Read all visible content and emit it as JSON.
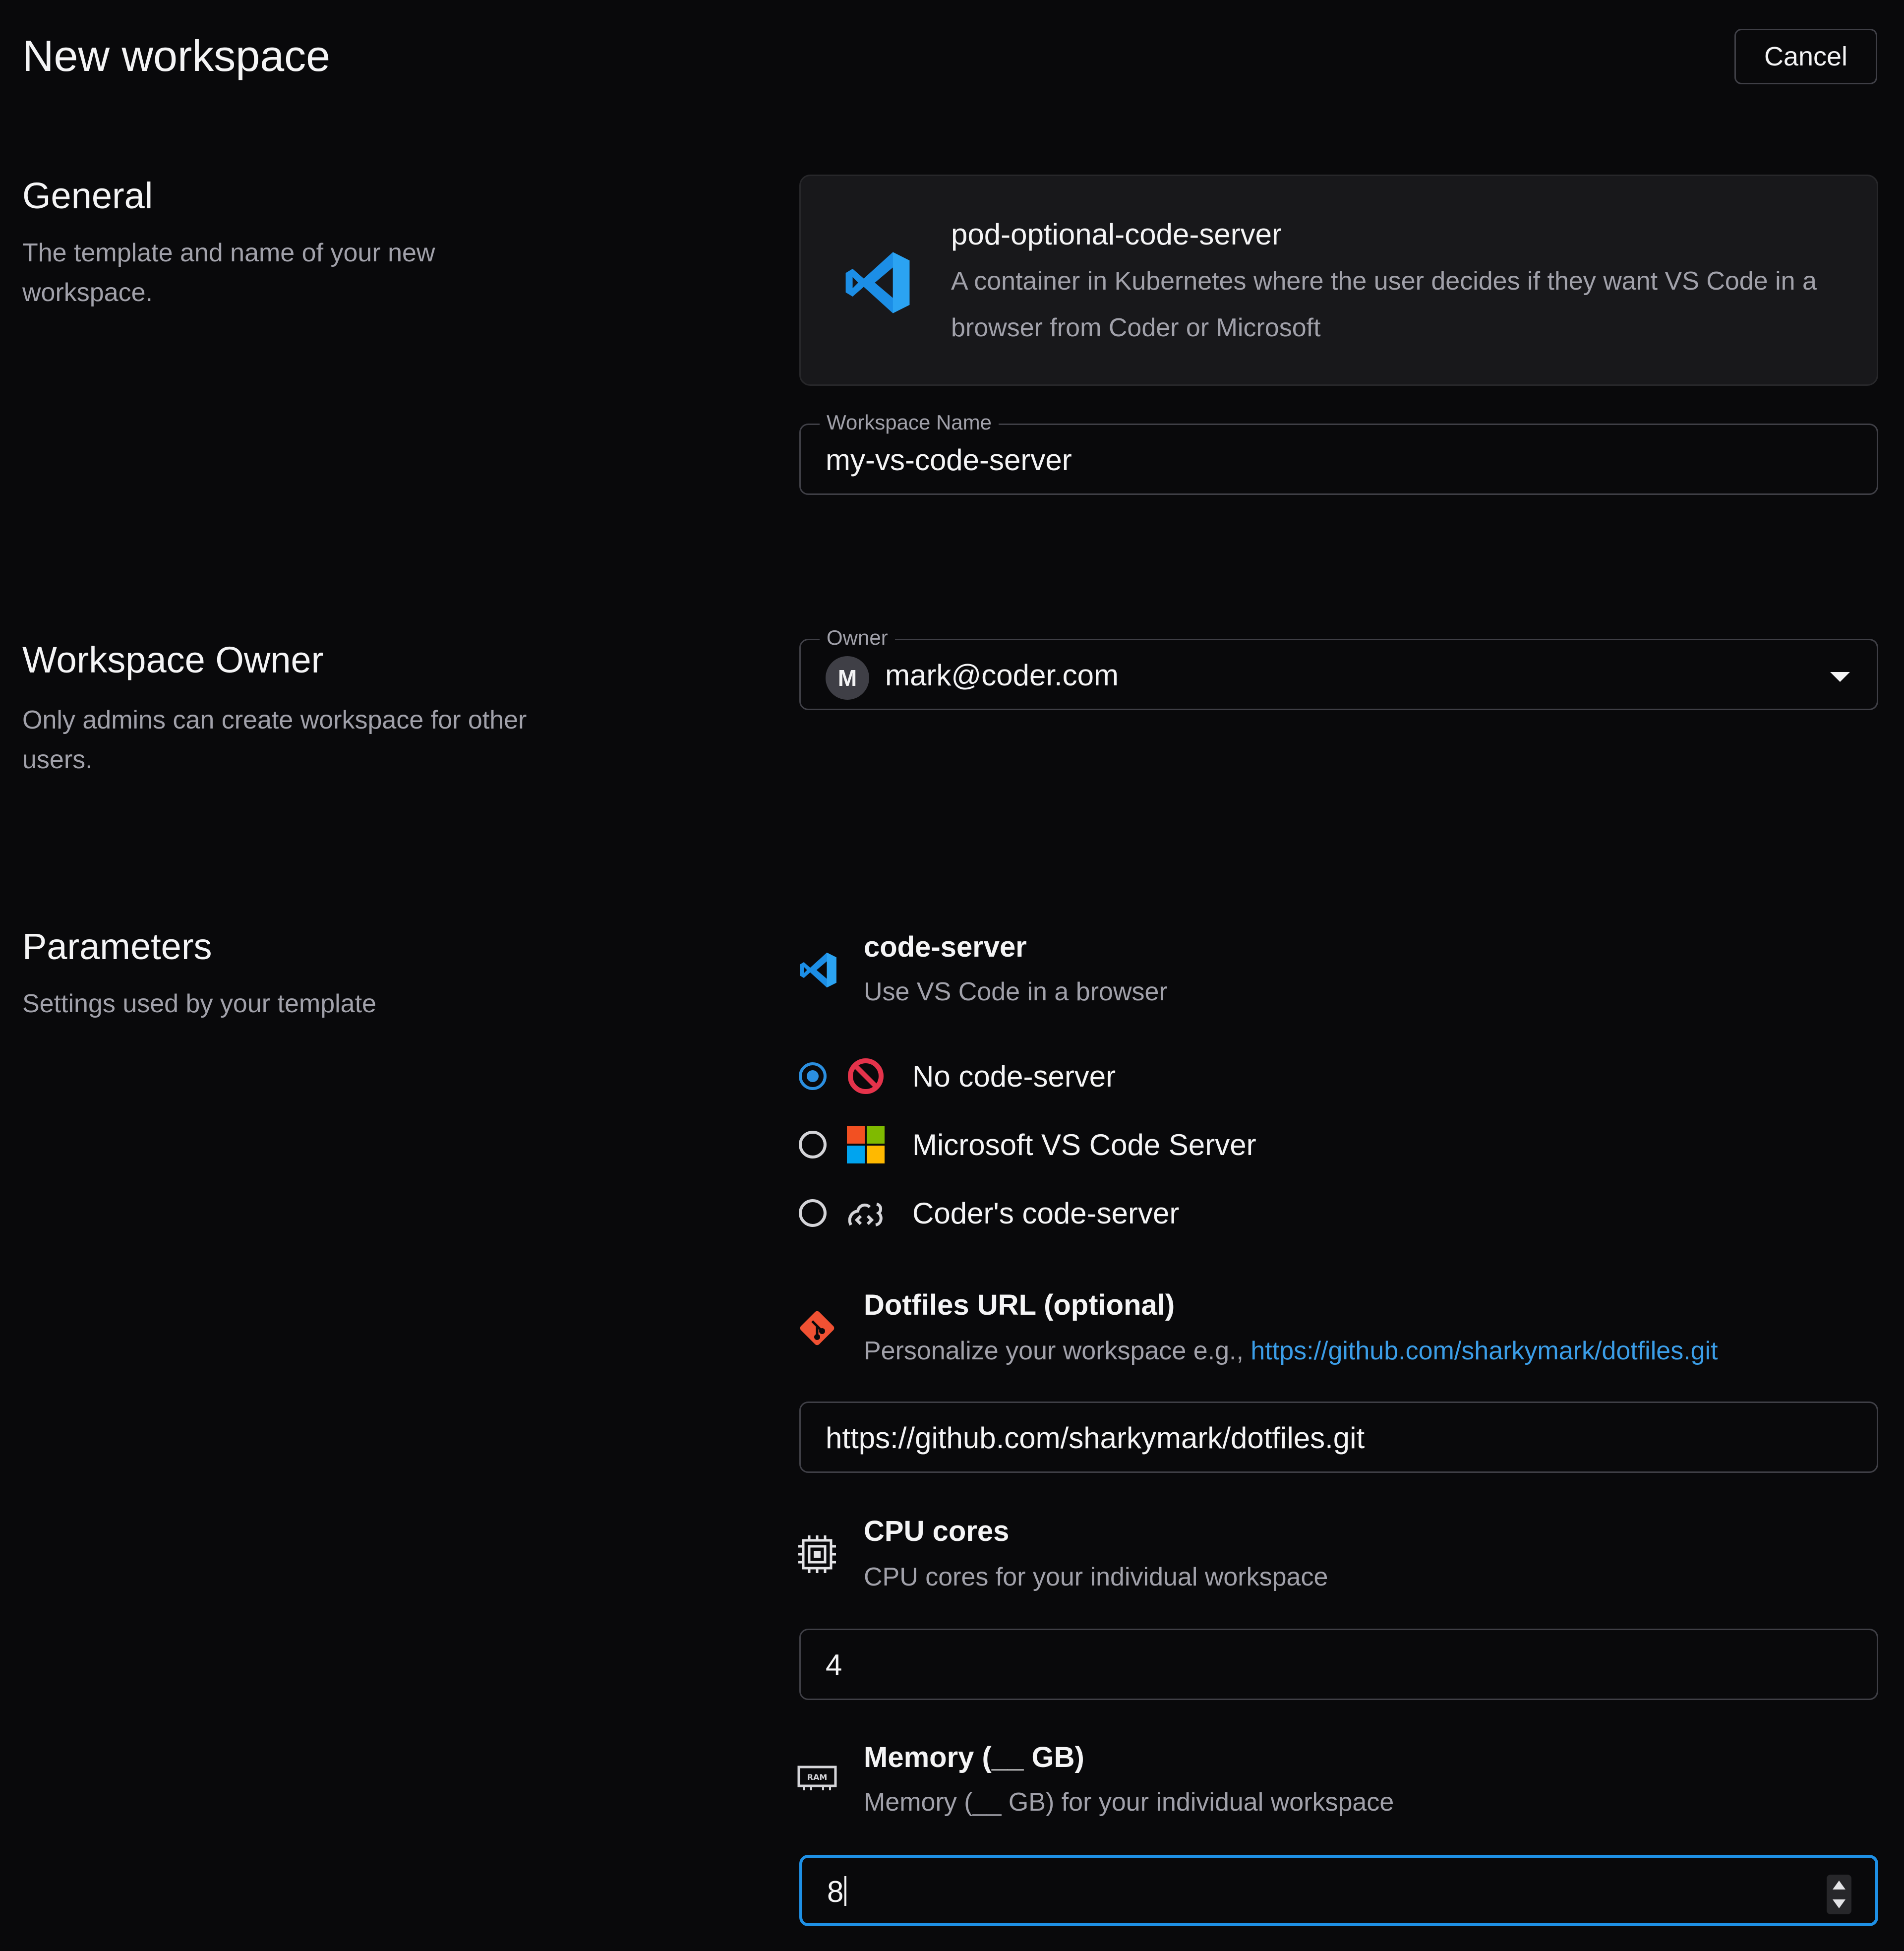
{
  "header": {
    "title": "New workspace",
    "cancel_label": "Cancel"
  },
  "general": {
    "title": "General",
    "description": "The template and name of your new workspace."
  },
  "template": {
    "icon": "vscode-icon",
    "name": "pod-optional-code-server",
    "description": "A container in Kubernetes where the user decides if they want VS Code in a browser from Coder or Microsoft"
  },
  "workspace_name": {
    "label": "Workspace Name",
    "value": "my-vs-code-server"
  },
  "owner_section": {
    "title": "Workspace Owner",
    "description": "Only admins can create workspace for other users."
  },
  "owner": {
    "label": "Owner",
    "avatar_initial": "M",
    "value": "mark@coder.com"
  },
  "parameters_section": {
    "title": "Parameters",
    "description": "Settings used by your template"
  },
  "code_server": {
    "icon": "vscode-icon",
    "title": "code-server",
    "description": "Use VS Code in a browser",
    "options": [
      {
        "label": "No code-server",
        "icon": "prohibited-icon",
        "selected": true
      },
      {
        "label": "Microsoft VS Code Server",
        "icon": "microsoft-icon",
        "selected": false
      },
      {
        "label": "Coder's code-server",
        "icon": "coder-icon",
        "selected": false
      }
    ]
  },
  "dotfiles": {
    "icon": "git-icon",
    "title": "Dotfiles URL (optional)",
    "description_prefix": "Personalize your workspace e.g., ",
    "description_link": "https://github.com/sharkymark/dotfiles.git",
    "value": "https://github.com/sharkymark/dotfiles.git"
  },
  "cpu": {
    "icon": "cpu-icon",
    "title": "CPU cores",
    "description": "CPU cores for your individual workspace",
    "value": "4"
  },
  "memory": {
    "icon": "ram-icon",
    "title": "Memory (__ GB)",
    "description": "Memory (__ GB) for your individual workspace",
    "value": "8",
    "icon_text": "RAM"
  },
  "colors": {
    "background": "#09090b",
    "card": "#18181b",
    "border": "#3f3f46",
    "accent": "#1e90e6",
    "link": "#3b9ee8",
    "muted_text": "#a1a1aa"
  }
}
